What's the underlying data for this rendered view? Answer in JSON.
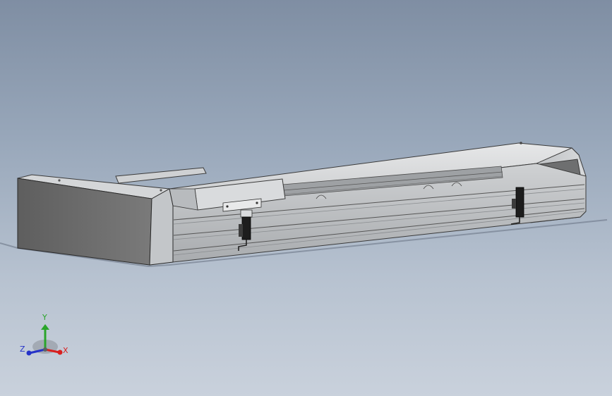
{
  "view": {
    "background_top": "#7f8ea3",
    "background_bottom": "#c9d1dc",
    "model_body_color": "#d6d8d9",
    "model_edge_color": "#3a3a3a",
    "end_cap_color": "#6b6b6b"
  },
  "triad": {
    "x_label": "X",
    "y_label": "Y",
    "z_label": "Z",
    "x_color": "#d81f1f",
    "y_color": "#2aa52a",
    "z_color": "#2432c8"
  }
}
